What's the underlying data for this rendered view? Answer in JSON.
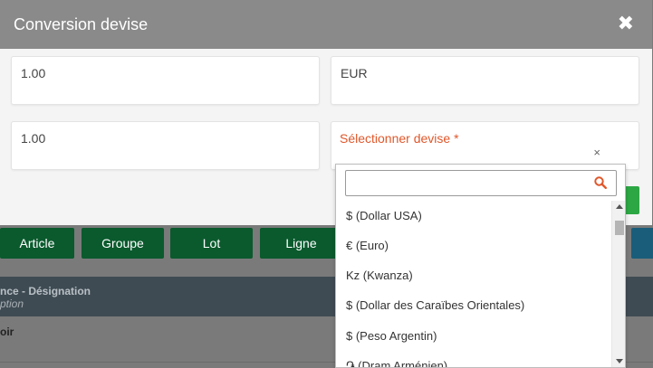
{
  "modal": {
    "title": "Conversion devise",
    "close_icon": "close-icon",
    "fields": {
      "amount_from": "1.00",
      "currency_from": "EUR",
      "amount_to": "1.00",
      "currency_to_label": "Sélectionner devise *",
      "clear_glyph": "×"
    }
  },
  "dropdown": {
    "search": {
      "value": "",
      "placeholder": ""
    },
    "options": [
      "$ (Dollar USA)",
      "€ (Euro)",
      "Kz (Kwanza)",
      "$ (Dollar des Caraïbes Orientales)",
      "$ (Peso Argentin)",
      "֏ (Dram Arménien)"
    ]
  },
  "background": {
    "buttons": [
      "Article",
      "Groupe",
      "Lot",
      "Ligne"
    ],
    "table_header": {
      "col1": "nce - Désignation",
      "col1_sub": "ption"
    },
    "row_text": "oir"
  },
  "colors": {
    "modal_header": "#8a8a8a",
    "required_label": "#e0572a",
    "search_icon": "#e0572a",
    "primary_green": "#2da744",
    "bg_buttons": "#0a5a2d"
  }
}
